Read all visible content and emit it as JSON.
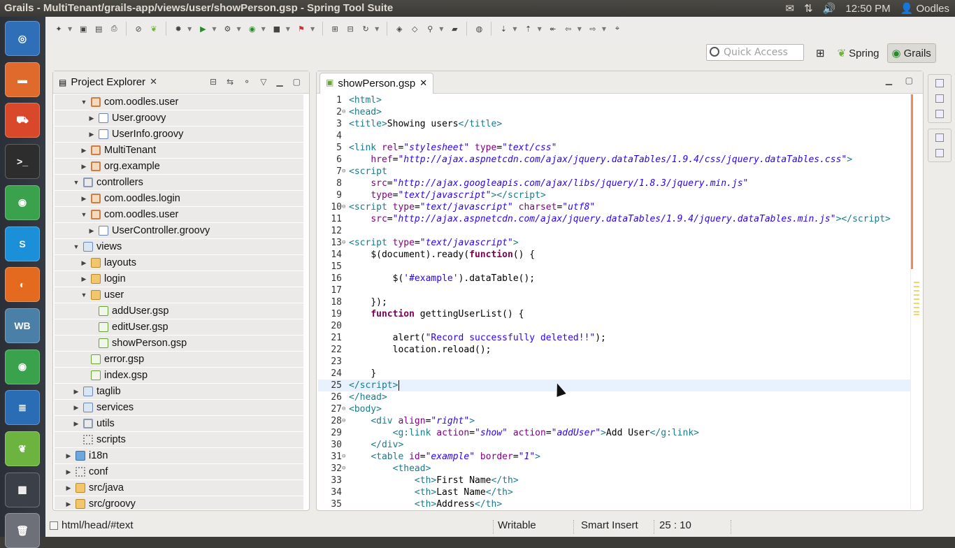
{
  "window": {
    "title": "Grails - MultiTenant/grails-app/views/user/showPerson.gsp - Spring Tool Suite"
  },
  "tray": {
    "time": "12:50 PM",
    "user": "Oodles"
  },
  "launcher": {
    "items": [
      {
        "name": "dash-home",
        "glyph": "◎",
        "color": "#2f6fb7"
      },
      {
        "name": "files",
        "glyph": "▬",
        "color": "#e06a2c"
      },
      {
        "name": "software-center",
        "glyph": "⛟",
        "color": "#d9482b"
      },
      {
        "name": "terminal",
        "glyph": ">_",
        "color": "#2d2d2d"
      },
      {
        "name": "chrome",
        "glyph": "◉",
        "color": "#3aa14d"
      },
      {
        "name": "skype",
        "glyph": "S",
        "color": "#1b8fd8"
      },
      {
        "name": "firefox",
        "glyph": "◐",
        "color": "#e36a1e"
      },
      {
        "name": "mysql-workbench",
        "glyph": "WB",
        "color": "#4a7fa8"
      },
      {
        "name": "chrome-2",
        "glyph": "◉",
        "color": "#3aa14d"
      },
      {
        "name": "libreoffice-writer",
        "glyph": "≣",
        "color": "#2a6db5"
      },
      {
        "name": "spring-tool-suite",
        "glyph": "❦",
        "color": "#6db33f"
      },
      {
        "name": "workspace-switcher",
        "glyph": "▦",
        "color": "#3b3f48"
      },
      {
        "name": "trash",
        "glyph": "🗑",
        "color": "#6d7078"
      }
    ]
  },
  "search": {
    "placeholder": "Quick Access"
  },
  "perspectives": {
    "spring": "Spring",
    "grails": "Grails"
  },
  "explorer": {
    "title": "Project Explorer",
    "rows": [
      {
        "label": "com.oodles.user",
        "indent": 1,
        "tw": "▼",
        "icon": "pkg"
      },
      {
        "label": "User.groovy",
        "indent": 2,
        "tw": "▶",
        "icon": "file"
      },
      {
        "label": "UserInfo.groovy",
        "indent": 2,
        "tw": "▶",
        "icon": "file"
      },
      {
        "label": "MultiTenant",
        "indent": 1,
        "tw": "▶",
        "icon": "pkg"
      },
      {
        "label": "org.example",
        "indent": 1,
        "tw": "▶",
        "icon": "pkg"
      },
      {
        "label": "controllers",
        "indent": 0,
        "tw": "▼",
        "icon": "ctrl"
      },
      {
        "label": "com.oodles.login",
        "indent": 1,
        "tw": "▶",
        "icon": "pkg"
      },
      {
        "label": "com.oodles.user",
        "indent": 1,
        "tw": "▼",
        "icon": "pkg"
      },
      {
        "label": "UserController.groovy",
        "indent": 2,
        "tw": "▶",
        "icon": "file"
      },
      {
        "label": "views",
        "indent": 0,
        "tw": "▼",
        "icon": "views"
      },
      {
        "label": "layouts",
        "indent": 1,
        "tw": "▶",
        "icon": "folder"
      },
      {
        "label": "login",
        "indent": 1,
        "tw": "▶",
        "icon": "folder"
      },
      {
        "label": "user",
        "indent": 1,
        "tw": "▼",
        "icon": "folder"
      },
      {
        "label": "addUser.gsp",
        "indent": 2,
        "tw": "",
        "icon": "gsp"
      },
      {
        "label": "editUser.gsp",
        "indent": 2,
        "tw": "",
        "icon": "gsp"
      },
      {
        "label": "showPerson.gsp",
        "indent": 2,
        "tw": "",
        "icon": "gsp"
      },
      {
        "label": "error.gsp",
        "indent": 1,
        "tw": "",
        "icon": "gsp"
      },
      {
        "label": "index.gsp",
        "indent": 1,
        "tw": "",
        "icon": "gsp"
      },
      {
        "label": "taglib",
        "indent": 0,
        "tw": "▶",
        "icon": "views"
      },
      {
        "label": "services",
        "indent": 0,
        "tw": "▶",
        "icon": "views"
      },
      {
        "label": "utils",
        "indent": 0,
        "tw": "▶",
        "icon": "ctrl"
      },
      {
        "label": "scripts",
        "indent": 0,
        "tw": "",
        "icon": "gear"
      },
      {
        "label": "i18n",
        "indent": -1,
        "tw": "▶",
        "icon": "globe"
      },
      {
        "label": "conf",
        "indent": -1,
        "tw": "▶",
        "icon": "gear"
      },
      {
        "label": "src/java",
        "indent": -1,
        "tw": "▶",
        "icon": "src"
      },
      {
        "label": "src/groovy",
        "indent": -1,
        "tw": "▶",
        "icon": "src"
      }
    ]
  },
  "editor": {
    "tab": "showPerson.gsp",
    "current_line": 25,
    "lines": [
      {
        "n": "1",
        "f": "",
        "html": "<span class='t'>&lt;html&gt;</span>"
      },
      {
        "n": "2",
        "f": "⊖",
        "html": "<span class='t'>&lt;head&gt;</span>"
      },
      {
        "n": "3",
        "f": "",
        "html": "<span class='t'>&lt;title&gt;</span><span class='p'>Showing users</span><span class='t'>&lt;/title&gt;</span>"
      },
      {
        "n": "4",
        "f": "",
        "html": ""
      },
      {
        "n": "5",
        "f": "",
        "html": "<span class='t'>&lt;link </span><span class='a'>rel</span><span class='p'>=</span><span class='v'>\"stylesheet\"</span> <span class='a'>type</span><span class='p'>=</span><span class='v'>\"text/css\"</span>"
      },
      {
        "n": "6",
        "f": "",
        "html": "    <span class='a'>href</span><span class='p'>=</span><span class='v'>\"http://ajax.aspnetcdn.com/ajax/jquery.dataTables/1.9.4/css/jquery.dataTables.css\"</span><span class='t'>&gt;</span>"
      },
      {
        "n": "7",
        "f": "⊖",
        "html": "<span class='t'>&lt;script</span>"
      },
      {
        "n": "8",
        "f": "",
        "html": "    <span class='a'>src</span><span class='p'>=</span><span class='v'>\"http://ajax.googleapis.com/ajax/libs/jquery/1.8.3/jquery.min.js\"</span>"
      },
      {
        "n": "9",
        "f": "",
        "html": "    <span class='a'>type</span><span class='p'>=</span><span class='v'>\"text/javascript\"</span><span class='t'>&gt;&lt;/script&gt;</span>"
      },
      {
        "n": "10",
        "f": "⊖",
        "html": "<span class='t'>&lt;script </span><span class='a'>type</span><span class='p'>=</span><span class='v'>\"text/javascript\"</span> <span class='a'>charset</span><span class='p'>=</span><span class='v'>\"utf8\"</span>"
      },
      {
        "n": "11",
        "f": "",
        "html": "    <span class='a'>src</span><span class='p'>=</span><span class='v'>\"http://ajax.aspnetcdn.com/ajax/jquery.dataTables/1.9.4/jquery.dataTables.min.js\"</span><span class='t'>&gt;&lt;/script&gt;</span>"
      },
      {
        "n": "12",
        "f": "",
        "html": ""
      },
      {
        "n": "13",
        "f": "⊖",
        "html": "<span class='t'>&lt;script </span><span class='a'>type</span><span class='p'>=</span><span class='v'>\"text/javascript\"</span><span class='t'>&gt;</span>"
      },
      {
        "n": "14",
        "f": "",
        "html": "    <span class='p'>$(document).ready(</span><span class='k'>function</span><span class='p'>() {</span>"
      },
      {
        "n": "15",
        "f": "",
        "html": ""
      },
      {
        "n": "16",
        "f": "",
        "html": "        <span class='p'>$(</span><span class='s'>'#example'</span><span class='p'>).dataTable();</span>"
      },
      {
        "n": "17",
        "f": "",
        "html": ""
      },
      {
        "n": "18",
        "f": "",
        "html": "    <span class='p'>});</span>"
      },
      {
        "n": "19",
        "f": "",
        "html": "    <span class='k'>function</span> <span class='p'>gettingUserList() {</span>"
      },
      {
        "n": "20",
        "f": "",
        "html": ""
      },
      {
        "n": "21",
        "f": "",
        "html": "        <span class='p'>alert(</span><span class='s'>\"Record successfully deleted!!\"</span><span class='p'>);</span>"
      },
      {
        "n": "22",
        "f": "",
        "html": "        <span class='p'>location.reload();</span>"
      },
      {
        "n": "23",
        "f": "",
        "html": ""
      },
      {
        "n": "24",
        "f": "",
        "html": "    <span class='p'>}</span>"
      },
      {
        "n": "25",
        "f": "",
        "html": "<span class='t'>&lt;/script&gt;</span>"
      },
      {
        "n": "26",
        "f": "",
        "html": "<span class='t'>&lt;/head&gt;</span>"
      },
      {
        "n": "27",
        "f": "⊖",
        "html": "<span class='t'>&lt;body&gt;</span>"
      },
      {
        "n": "28",
        "f": "⊖",
        "html": "    <span class='t'>&lt;div </span><span class='a'>align</span><span class='p'>=</span><span class='v'>\"right\"</span><span class='t'>&gt;</span>"
      },
      {
        "n": "29",
        "f": "",
        "html": "        <span class='t'>&lt;g:link </span><span class='a'>action</span><span class='p'>=</span><span class='v'>\"show\"</span> <span class='a'>action</span><span class='p'>=</span><span class='v'>\"addUser\"</span><span class='t'>&gt;</span><span class='p'>Add User</span><span class='t'>&lt;/g:link&gt;</span>"
      },
      {
        "n": "30",
        "f": "",
        "html": "    <span class='t'>&lt;/div&gt;</span>"
      },
      {
        "n": "31",
        "f": "⊖",
        "html": "    <span class='t'>&lt;table </span><span class='a'>id</span><span class='p'>=</span><span class='v'>\"example\"</span> <span class='a'>border</span><span class='p'>=</span><span class='v'>\"1\"</span><span class='t'>&gt;</span>"
      },
      {
        "n": "32",
        "f": "⊖",
        "html": "        <span class='t'>&lt;thead&gt;</span>"
      },
      {
        "n": "33",
        "f": "",
        "html": "            <span class='t'>&lt;th&gt;</span><span class='p'>First Name</span><span class='t'>&lt;/th&gt;</span>"
      },
      {
        "n": "34",
        "f": "",
        "html": "            <span class='t'>&lt;th&gt;</span><span class='p'>Last Name</span><span class='t'>&lt;/th&gt;</span>"
      },
      {
        "n": "35",
        "f": "",
        "html": "            <span class='t'>&lt;th&gt;</span><span class='p'>Address</span><span class='t'>&lt;/th&gt;</span>"
      }
    ]
  },
  "status": {
    "path": "html/head/#text",
    "writable": "Writable",
    "insert_mode": "Smart Insert",
    "position": "25 : 10"
  }
}
